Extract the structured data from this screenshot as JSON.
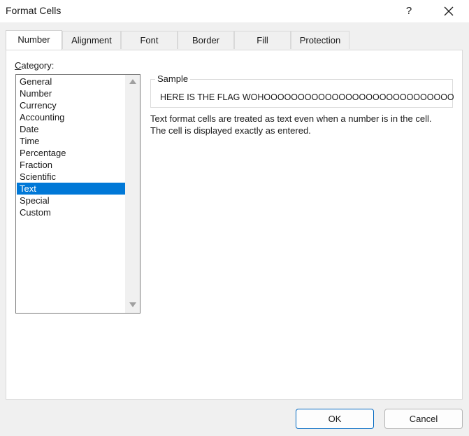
{
  "window": {
    "title": "Format Cells",
    "help_label": "?"
  },
  "tabs": [
    {
      "label": "Number",
      "active": true
    },
    {
      "label": "Alignment"
    },
    {
      "label": "Font"
    },
    {
      "label": "Border"
    },
    {
      "label": "Fill"
    },
    {
      "label": "Protection"
    }
  ],
  "category": {
    "label_prefix": "C",
    "label_rest": "ategory:",
    "items": [
      "General",
      "Number",
      "Currency",
      "Accounting",
      "Date",
      "Time",
      "Percentage",
      "Fraction",
      "Scientific",
      "Text",
      "Special",
      "Custom"
    ],
    "selected": "Text"
  },
  "sample": {
    "legend": "Sample",
    "value": "HERE IS THE FLAG WOHOOOOOOOOOOOOOOOOOOOOOOOOOOOO"
  },
  "description": {
    "line1": "Text format cells are treated as text even when a number is in the cell.",
    "line2": "The cell is displayed exactly as entered."
  },
  "buttons": {
    "ok": "OK",
    "cancel": "Cancel"
  },
  "colors": {
    "selection": "#0078d7",
    "ok_border": "#0067c0"
  }
}
